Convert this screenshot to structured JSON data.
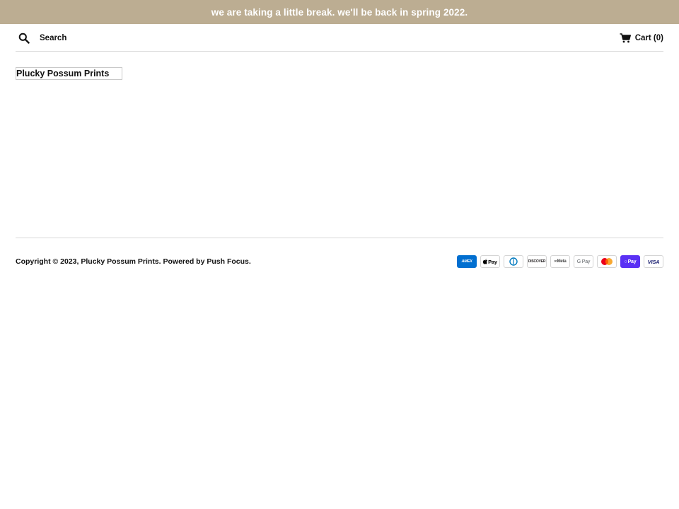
{
  "announcement": {
    "text": "we are taking a little break. we'll be back in spring 2022."
  },
  "header": {
    "search_label": "Search",
    "cart_label": "Cart (0)"
  },
  "logo": {
    "text": "Plucky Possum Prints"
  },
  "footer": {
    "copyright_prefix": "Copyright © 2023,",
    "shop_name": "Plucky Possum Prints",
    "powered_by": ". Powered by",
    "powered_link": "Push Focus",
    "suffix": "."
  },
  "payments": [
    {
      "name": "amex",
      "label": "AMEX",
      "icon": "amex-icon"
    },
    {
      "name": "apple-pay",
      "label": "Pay",
      "icon": "apple-pay-icon"
    },
    {
      "name": "diners",
      "label": "◐◑",
      "icon": "diners-club-icon"
    },
    {
      "name": "discover",
      "label": "DISCOVER",
      "icon": "discover-icon"
    },
    {
      "name": "meta-pay",
      "label": "∞Meta",
      "icon": "meta-pay-icon"
    },
    {
      "name": "google-pay",
      "label": "G Pay",
      "icon": "google-pay-icon"
    },
    {
      "name": "mastercard",
      "label": "",
      "icon": "mastercard-icon"
    },
    {
      "name": "shop-pay",
      "label": "Pay",
      "icon": "shop-pay-icon"
    },
    {
      "name": "visa",
      "label": "VISA",
      "icon": "visa-icon"
    }
  ],
  "colors": {
    "announcement_bg": "#bcad92",
    "announcement_text": "#ffffff",
    "rule": "#d8d8d8"
  }
}
